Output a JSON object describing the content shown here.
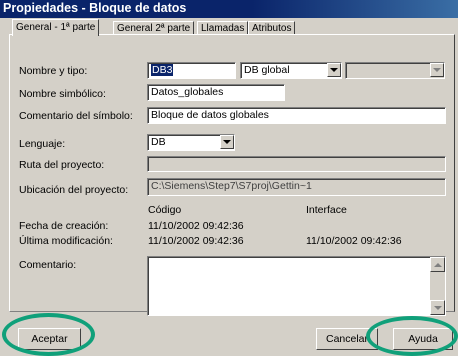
{
  "window": {
    "title": "Propiedades - Bloque de datos"
  },
  "tabs": [
    {
      "label": "General - 1ª parte"
    },
    {
      "label": "General  2ª parte"
    },
    {
      "label": "Llamadas"
    },
    {
      "label": "Atributos"
    }
  ],
  "form": {
    "name_type": {
      "label": "Nombre y tipo:",
      "value": "DB3",
      "type_value": "DB global",
      "extra_value": ""
    },
    "symbolic_name": {
      "label": "Nombre simbólico:",
      "value": "Datos_globales"
    },
    "symbol_comment": {
      "label": "Comentario del símbolo:",
      "value": "Bloque de datos globales"
    },
    "language": {
      "label": "Lenguaje:",
      "value": "DB"
    },
    "project_path": {
      "label": "Ruta del proyecto:",
      "value": ""
    },
    "project_location": {
      "label": "Ubicación del proyecto:",
      "value": "C:\\Siemens\\Step7\\S7proj\\Gettin~1"
    },
    "columns": {
      "code": "Código",
      "interface": "Interface"
    },
    "created": {
      "label": "Fecha de creación:",
      "code": "11/10/2002  09:42:36",
      "interface": ""
    },
    "modified": {
      "label": "Última modificación:",
      "code": "11/10/2002  09:42:36",
      "interface": "11/10/2002  09:42:36"
    },
    "comment": {
      "label": "Comentario:",
      "value": ""
    }
  },
  "buttons": {
    "ok": "Aceptar",
    "cancel": "Cancelar",
    "help": "Ayuda"
  },
  "colors": {
    "title_bar": "#0a246a",
    "dialog_face": "#d4d0c8",
    "highlight_ring": "#10a07a"
  }
}
